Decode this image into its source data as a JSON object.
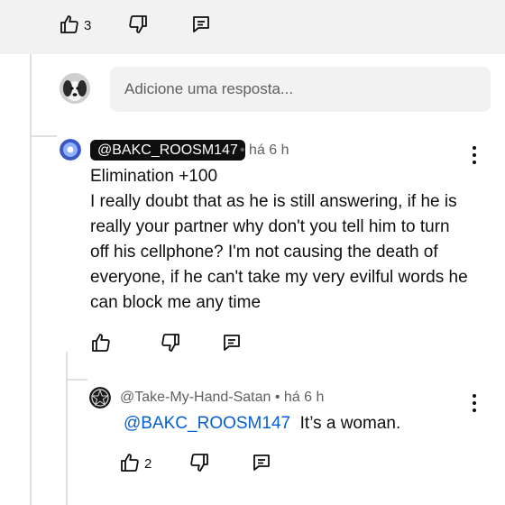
{
  "top_actions": {
    "like_count": "3"
  },
  "reply_input": {
    "placeholder": "Adicione uma resposta..."
  },
  "comment": {
    "author": "@BAKC_ROOSM147",
    "time": "• há 6 h",
    "lines": [
      "Elimination +100",
      "I really doubt that as he is still answering, if he is",
      "really your partner why don't you tell him to turn",
      "off his cellphone? I'm not causing the death of",
      "everyone, if he can't take my very evilful words he",
      "can block me any time"
    ]
  },
  "reply": {
    "author": "@Take-My-Hand-Satan",
    "time": "• há 6 h",
    "mention": "@BAKC_ROOSM147",
    "text": "It’s a woman.",
    "like_count": "2"
  },
  "colors": {
    "mention": "#065fd4",
    "badge_bg": "#0f0f0f",
    "panel_bg": "#f2f2f2"
  },
  "icons": [
    "thumbs-up-icon",
    "thumbs-down-icon",
    "reply-comment-icon",
    "more-options-icon"
  ]
}
